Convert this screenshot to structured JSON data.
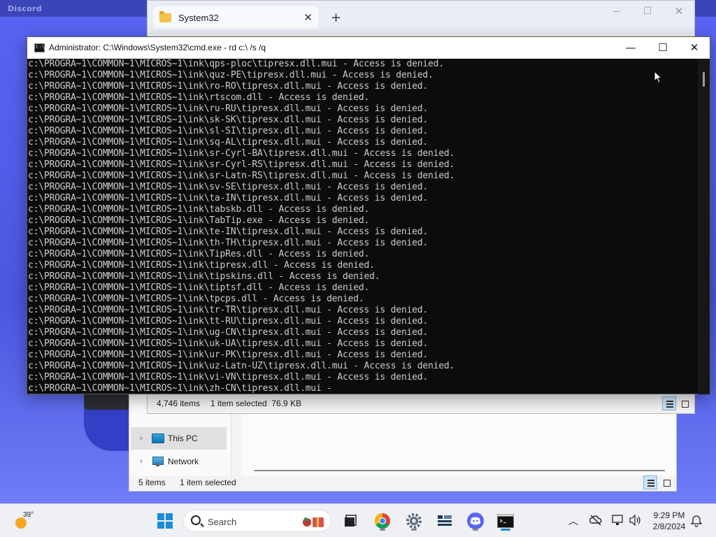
{
  "discord": {
    "title": "Discord"
  },
  "explorer": {
    "tab_title": "System32",
    "new_tab": "+",
    "controls": {
      "minimize": "—",
      "maximize": "☐",
      "close": "✕"
    },
    "status_items": "4,746 items",
    "status_selected": "1 item selected  76.9 KB"
  },
  "explorer2": {
    "nav_items": [
      {
        "label": "This PC",
        "chevron": "›"
      },
      {
        "label": "Network",
        "chevron": "›"
      }
    ],
    "status_items": "5 items",
    "status_selected": "1 item selected"
  },
  "cmd": {
    "title": "Administrator: C:\\Windows\\System32\\cmd.exe - rd  c:\\ /s /q",
    "controls": {
      "minimize": "—",
      "maximize": "☐",
      "close": "✕"
    },
    "lines": [
      "c:\\PROGRA~1\\COMMON~1\\MICROS~1\\ink\\qps-ploc\\tipresx.dll.mui - Access is denied.",
      "c:\\PROGRA~1\\COMMON~1\\MICROS~1\\ink\\quz-PE\\tipresx.dll.mui - Access is denied.",
      "c:\\PROGRA~1\\COMMON~1\\MICROS~1\\ink\\ro-RO\\tipresx.dll.mui - Access is denied.",
      "c:\\PROGRA~1\\COMMON~1\\MICROS~1\\ink\\rtscom.dll - Access is denied.",
      "c:\\PROGRA~1\\COMMON~1\\MICROS~1\\ink\\ru-RU\\tipresx.dll.mui - Access is denied.",
      "c:\\PROGRA~1\\COMMON~1\\MICROS~1\\ink\\sk-SK\\tipresx.dll.mui - Access is denied.",
      "c:\\PROGRA~1\\COMMON~1\\MICROS~1\\ink\\sl-SI\\tipresx.dll.mui - Access is denied.",
      "c:\\PROGRA~1\\COMMON~1\\MICROS~1\\ink\\sq-AL\\tipresx.dll.mui - Access is denied.",
      "c:\\PROGRA~1\\COMMON~1\\MICROS~1\\ink\\sr-Cyrl-BA\\tipresx.dll.mui - Access is denied.",
      "c:\\PROGRA~1\\COMMON~1\\MICROS~1\\ink\\sr-Cyrl-RS\\tipresx.dll.mui - Access is denied.",
      "c:\\PROGRA~1\\COMMON~1\\MICROS~1\\ink\\sr-Latn-RS\\tipresx.dll.mui - Access is denied.",
      "c:\\PROGRA~1\\COMMON~1\\MICROS~1\\ink\\sv-SE\\tipresx.dll.mui - Access is denied.",
      "c:\\PROGRA~1\\COMMON~1\\MICROS~1\\ink\\ta-IN\\tipresx.dll.mui - Access is denied.",
      "c:\\PROGRA~1\\COMMON~1\\MICROS~1\\ink\\tabskb.dll - Access is denied.",
      "c:\\PROGRA~1\\COMMON~1\\MICROS~1\\ink\\TabTip.exe - Access is denied.",
      "c:\\PROGRA~1\\COMMON~1\\MICROS~1\\ink\\te-IN\\tipresx.dll.mui - Access is denied.",
      "c:\\PROGRA~1\\COMMON~1\\MICROS~1\\ink\\th-TH\\tipresx.dll.mui - Access is denied.",
      "c:\\PROGRA~1\\COMMON~1\\MICROS~1\\ink\\TipRes.dll - Access is denied.",
      "c:\\PROGRA~1\\COMMON~1\\MICROS~1\\ink\\tipresx.dll - Access is denied.",
      "c:\\PROGRA~1\\COMMON~1\\MICROS~1\\ink\\tipskins.dll - Access is denied.",
      "c:\\PROGRA~1\\COMMON~1\\MICROS~1\\ink\\tiptsf.dll - Access is denied.",
      "c:\\PROGRA~1\\COMMON~1\\MICROS~1\\ink\\tpcps.dll - Access is denied.",
      "c:\\PROGRA~1\\COMMON~1\\MICROS~1\\ink\\tr-TR\\tipresx.dll.mui - Access is denied.",
      "c:\\PROGRA~1\\COMMON~1\\MICROS~1\\ink\\tt-RU\\tipresx.dll.mui - Access is denied.",
      "c:\\PROGRA~1\\COMMON~1\\MICROS~1\\ink\\ug-CN\\tipresx.dll.mui - Access is denied.",
      "c:\\PROGRA~1\\COMMON~1\\MICROS~1\\ink\\uk-UA\\tipresx.dll.mui - Access is denied.",
      "c:\\PROGRA~1\\COMMON~1\\MICROS~1\\ink\\ur-PK\\tipresx.dll.mui - Access is denied.",
      "c:\\PROGRA~1\\COMMON~1\\MICROS~1\\ink\\uz-Latn-UZ\\tipresx.dll.mui - Access is denied.",
      "c:\\PROGRA~1\\COMMON~1\\MICROS~1\\ink\\vi-VN\\tipresx.dll.mui - Access is denied.",
      "c:\\PROGRA~1\\COMMON~1\\MICROS~1\\ink\\zh-CN\\tipresx.dll.mui -"
    ]
  },
  "taskbar": {
    "weather_temp": "39°",
    "search_placeholder": "Search",
    "pinned": [
      "start-icon",
      "search",
      "task-view-icon",
      "chrome-icon",
      "settings-icon",
      "app-icon",
      "discord-icon",
      "terminal-icon"
    ],
    "tray_icons": [
      "chevron-up-icon",
      "onedrive-icon",
      "network-icon",
      "volume-icon"
    ],
    "time": "9:29 PM",
    "date": "2/8/2024"
  },
  "colors": {
    "discord_blue": "#5865f2",
    "terminal_bg": "#0c0c0c",
    "terminal_text": "#cccccc",
    "windows_accent": "#1a8cd8"
  }
}
